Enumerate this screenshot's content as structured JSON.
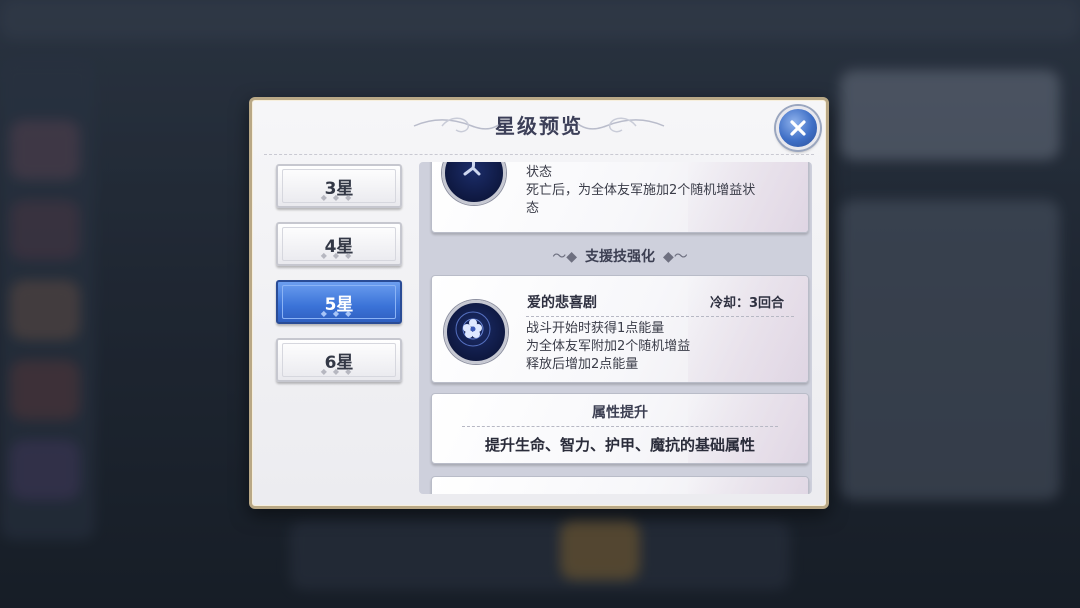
{
  "dialog": {
    "title": "星级预览"
  },
  "colors": {
    "accent": "#3b73d8",
    "frame": "#b9a886",
    "panel": "#ced0dc"
  },
  "icons": {
    "close": "close-icon",
    "skill": "skill-emblem-icon"
  },
  "star_tabs": [
    {
      "label": "3星",
      "active": false
    },
    {
      "label": "4星",
      "active": false
    },
    {
      "label": "5星",
      "active": true
    },
    {
      "label": "6星",
      "active": false
    }
  ],
  "top_card": {
    "lines": [
      "状态",
      "死亡后，为全体友军施加2个随机增益状",
      "态"
    ]
  },
  "support_section": {
    "title": "支援技强化"
  },
  "support_skill": {
    "name": "爱的悲喜剧",
    "cooldown": "冷却：3回合",
    "lines": [
      "战斗开始时获得1点能量",
      "为全体友军附加2个随机增益",
      "释放后增加2点能量"
    ]
  },
  "attribute_boost": {
    "title": "属性提升",
    "description": "提升生命、智力、护甲、魔抗的基础属性"
  }
}
